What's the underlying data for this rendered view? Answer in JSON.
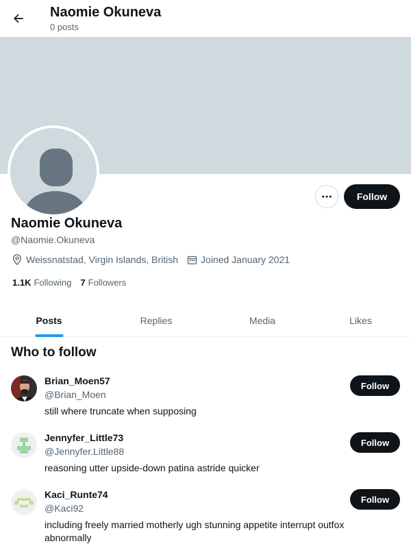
{
  "header": {
    "title": "Naomie Okuneva",
    "post_count": "0 posts"
  },
  "profile": {
    "name": "Naomie Okuneva",
    "handle": "@Naomie.Okuneva",
    "location": "Weissnatstad, Virgin Islands, British",
    "joined": "Joined January 2021",
    "following_count": "1.1K",
    "following_label": "Following",
    "followers_count": "7",
    "followers_label": "Followers",
    "follow_label": "Follow",
    "banner_color": "#cfd9de"
  },
  "tabs": [
    {
      "label": "Posts",
      "active": true
    },
    {
      "label": "Replies",
      "active": false
    },
    {
      "label": "Media",
      "active": false
    },
    {
      "label": "Likes",
      "active": false
    }
  ],
  "who_to_follow": {
    "title": "Who to follow",
    "users": [
      {
        "name": "Brian_Moen57",
        "handle": "@Brian_Moen",
        "bio": "still where truncate when supposing",
        "follow_label": "Follow"
      },
      {
        "name": "Jennyfer_Little73",
        "handle": "@Jennyfer.Little88",
        "bio": "reasoning utter upside-down patina astride quicker",
        "follow_label": "Follow"
      },
      {
        "name": "Kaci_Runte74",
        "handle": "@Kaci92",
        "bio": "including freely married motherly ugh stunning appetite interrupt outfox abnormally",
        "follow_label": "Follow"
      }
    ]
  },
  "colors": {
    "accent": "#1d9bf0",
    "text_primary": "#0f1419",
    "text_secondary": "#536471",
    "button_dark": "#0f1419"
  }
}
